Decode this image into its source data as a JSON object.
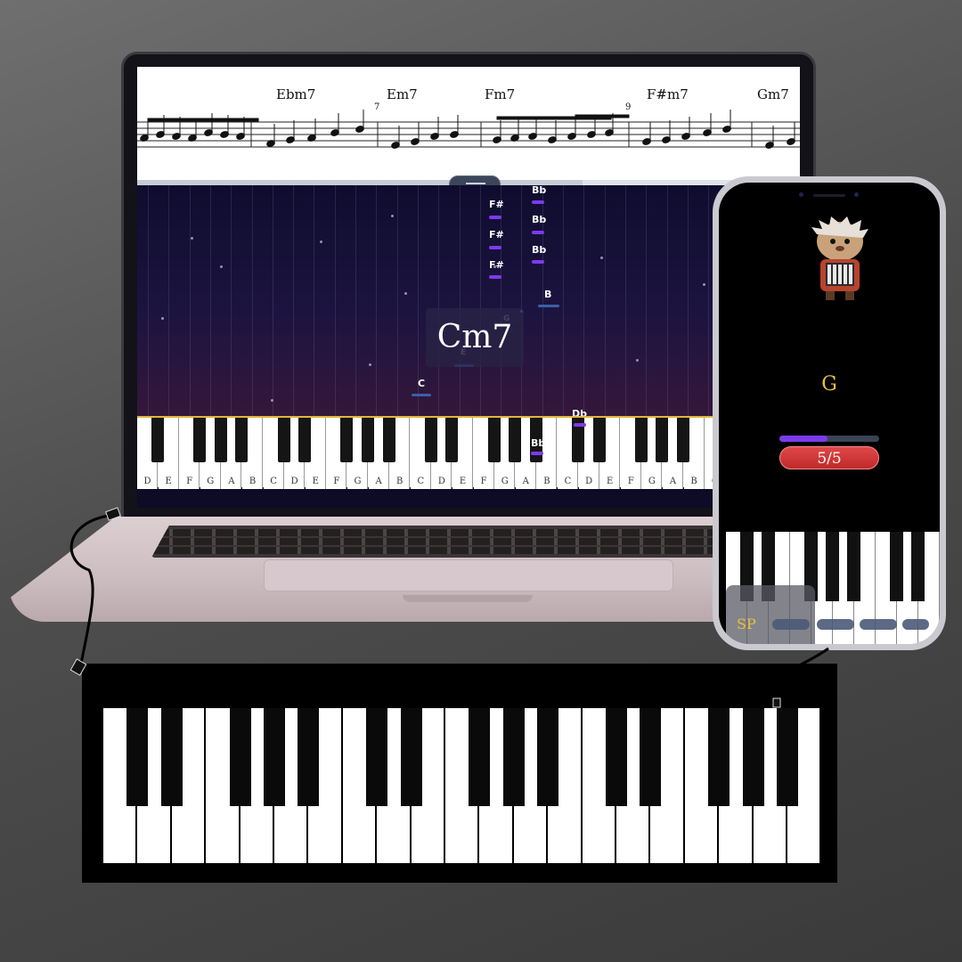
{
  "sheet": {
    "chords": [
      "Ebm7",
      "Em7",
      "Fm7",
      "F#m7",
      "Gm7"
    ],
    "measure_numbers": [
      "7",
      "7",
      "9"
    ]
  },
  "falling_notes": {
    "labels": [
      "F#",
      "F#",
      "F#",
      "Bb",
      "Bb",
      "Bb",
      "B",
      "G",
      "E",
      "C",
      "Db",
      "Bb"
    ],
    "current_chord": "Cm7"
  },
  "laptop_keyboard": {
    "white_key_labels": [
      "D",
      "E",
      "F",
      "G",
      "A",
      "B",
      "C",
      "D",
      "E",
      "F",
      "G",
      "A",
      "B",
      "C",
      "D",
      "E",
      "F",
      "G",
      "A",
      "B",
      "C",
      "D",
      "E",
      "F",
      "G",
      "A",
      "B",
      "C",
      "D",
      "E",
      "F",
      "G",
      "A",
      "B"
    ]
  },
  "phone": {
    "target_note": "G",
    "progress": 0.48,
    "score": "5/5",
    "sp_label": "SP"
  },
  "colors": {
    "accent_purple": "#7c3aed",
    "accent_gold": "#e8c13a",
    "score_red": "#d83838",
    "night_sky": "#0f0c2e"
  },
  "icons": [
    "drag-handle-icon",
    "usb-cable-icon",
    "mascot-hedgehog-icon"
  ]
}
